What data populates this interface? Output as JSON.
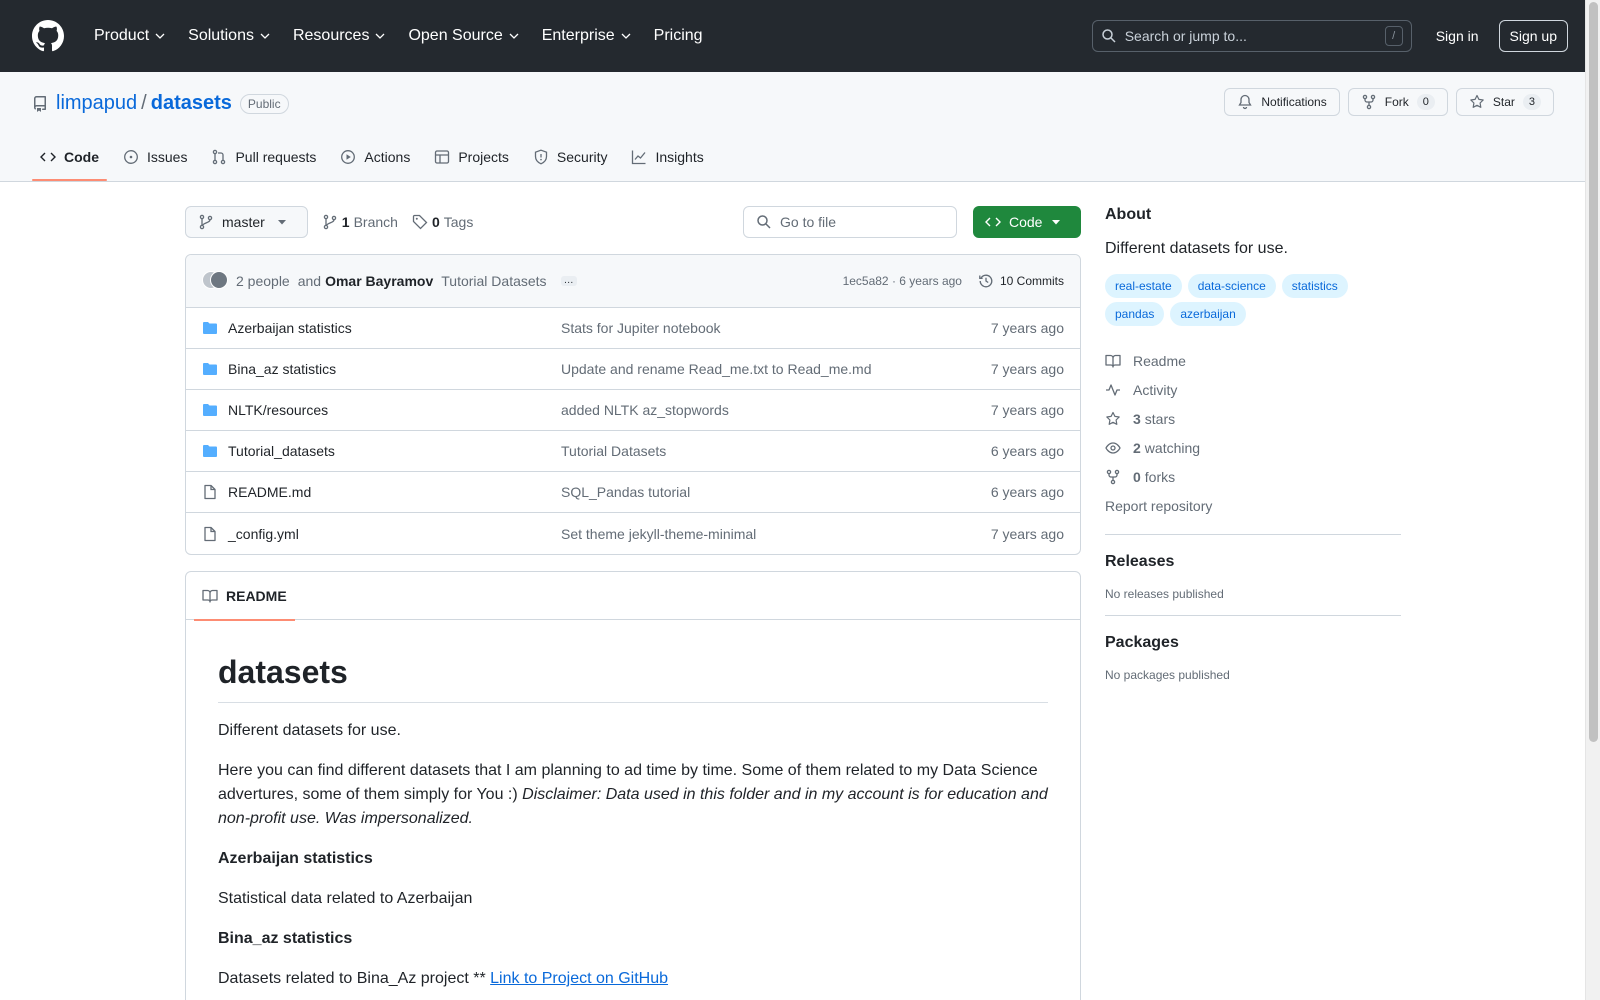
{
  "header": {
    "nav": [
      "Product",
      "Solutions",
      "Resources",
      "Open Source",
      "Enterprise"
    ],
    "pricing": "Pricing",
    "search_placeholder": "Search or jump to...",
    "search_shortcut": "/",
    "sign_in": "Sign in",
    "sign_up": "Sign up"
  },
  "repo": {
    "owner": "limpapud",
    "separator": "/",
    "name": "datasets",
    "visibility": "Public",
    "notifications_label": "Notifications",
    "fork_label": "Fork",
    "fork_count": "0",
    "star_label": "Star",
    "star_count": "3"
  },
  "tabs": [
    "Code",
    "Issues",
    "Pull requests",
    "Actions",
    "Projects",
    "Security",
    "Insights"
  ],
  "toolbar": {
    "branch": "master",
    "branch_count": "1",
    "branch_label": "Branch",
    "tag_count": "0",
    "tag_label": "Tags",
    "goto_placeholder": "Go to file",
    "code_label": "Code"
  },
  "commit": {
    "people": "2 people",
    "and": "and",
    "author": "Omar Bayramov",
    "message": "Tutorial Datasets",
    "ellipsis": "…",
    "sha_age": "1ec5a82 · 6 years ago",
    "commits": "10 Commits"
  },
  "files": [
    {
      "type": "dir",
      "name": "Azerbaijan statistics",
      "message": "Stats for Jupiter notebook",
      "age": "7 years ago"
    },
    {
      "type": "dir",
      "name": "Bina_az statistics",
      "message": "Update and rename Read_me.txt to Read_me.md",
      "age": "7 years ago"
    },
    {
      "type": "dir",
      "name": "NLTK/resources",
      "message": "added NLTK az_stopwords",
      "age": "7 years ago"
    },
    {
      "type": "dir",
      "name": "Tutorial_datasets",
      "message": "Tutorial Datasets",
      "age": "6 years ago"
    },
    {
      "type": "file",
      "name": "README.md",
      "message": "SQL_Pandas tutorial",
      "age": "6 years ago"
    },
    {
      "type": "file",
      "name": "_config.yml",
      "message": "Set theme jekyll-theme-minimal",
      "age": "7 years ago"
    }
  ],
  "readme": {
    "tab_label": "README",
    "title": "datasets",
    "p1": "Different datasets for use.",
    "p2_text": "Here you can find different datasets that I am planning to ad time by time. Some of them related to my Data Science advertures, some of them simply for You :) ",
    "p2_em": "Disclaimer: Data used in this folder and in my account is for education and non-profit use. Was impersonalized.",
    "h_az": "Azerbaijan statistics",
    "p_az": "Statistical data related to Azerbaijan",
    "h_bina": "Bina_az statistics",
    "p_bina_text": "Datasets related to Bina_Az project ** ",
    "p_bina_link": "Link to Project on GitHub"
  },
  "about": {
    "heading": "About",
    "description": "Different datasets for use.",
    "topics": [
      "real-estate",
      "data-science",
      "statistics",
      "pandas",
      "azerbaijan"
    ],
    "readme": "Readme",
    "activity": "Activity",
    "stars_count": "3",
    "stars_label": "stars",
    "watching_count": "2",
    "watching_label": "watching",
    "forks_count": "0",
    "forks_label": "forks",
    "report": "Report repository"
  },
  "releases": {
    "heading": "Releases",
    "empty": "No releases published"
  },
  "packages": {
    "heading": "Packages",
    "empty": "No packages published"
  }
}
